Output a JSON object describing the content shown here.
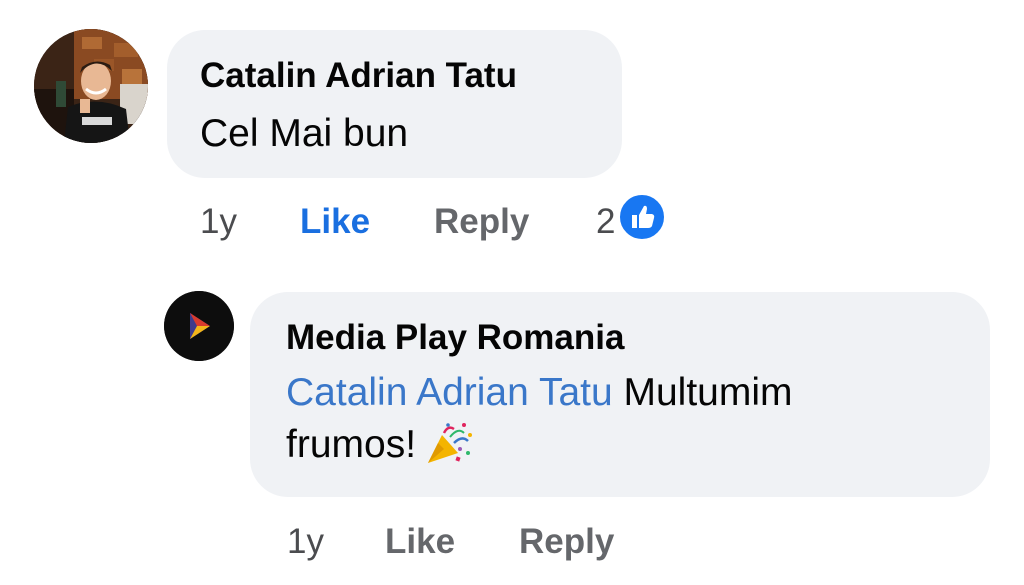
{
  "comments": [
    {
      "author": "Catalin Adrian Tatu",
      "text": "Cel Mai bun",
      "time": "1y",
      "like_label": "Like",
      "reply_label": "Reply",
      "reaction_count": "2",
      "liked": true
    }
  ],
  "reply": {
    "author": "Media Play Romania",
    "mention": "Catalin Adrian Tatu",
    "text_line1": " Multumim",
    "text_line2": "frumos!",
    "emoji": "party-popper",
    "time": "1y",
    "like_label": "Like",
    "reply_label": "Reply"
  },
  "colors": {
    "bubble": "#f0f2f5",
    "link": "#3a77c9",
    "like_active": "#1a6fe0",
    "muted": "#65676b"
  }
}
